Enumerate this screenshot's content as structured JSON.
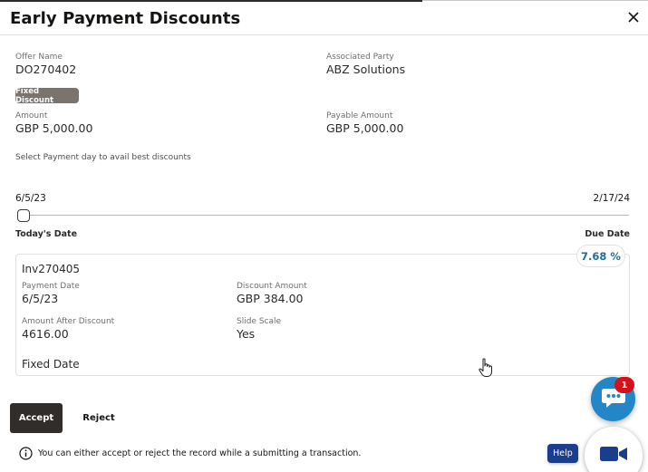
{
  "dialog": {
    "title": "Early Payment Discounts"
  },
  "offer": {
    "offer_name_label": "Offer Name",
    "offer_name": "DO270402",
    "party_label": "Associated Party",
    "party": "ABZ Solutions",
    "badge": "Fixed Discount",
    "amount_label": "Amount",
    "amount": "GBP 5,000.00",
    "payable_label": "Payable Amount",
    "payable": "GBP 5,000.00"
  },
  "slider": {
    "hint": "Select Payment day to avail best discounts",
    "start_date": "6/5/23",
    "end_date": "2/17/24",
    "start_label": "Today's Date",
    "end_label": "Due Date",
    "position": 0
  },
  "card": {
    "discount_percent": "7.68 %",
    "invoice": "Inv270405",
    "payment_date_label": "Payment Date",
    "payment_date": "6/5/23",
    "discount_amount_label": "Discount Amount",
    "discount_amount": "GBP 384.00",
    "after_discount_label": "Amount After Discount",
    "after_discount": "4616.00",
    "slide_scale_label": "Slide Scale",
    "slide_scale": "Yes",
    "footer": "Fixed Date"
  },
  "actions": {
    "accept": "Accept",
    "reject": "Reject",
    "info": "You can either accept or reject the record while a submitting a transaction."
  },
  "widgets": {
    "chat_badge": "1",
    "help": "Help"
  },
  "icons": {
    "close": "close-icon",
    "info": "info-icon",
    "chat": "chat-bubble-icon",
    "video": "video-camera-icon",
    "pointer": "hand-pointer-icon"
  },
  "colors": {
    "accent": "#1f6f95",
    "primary_button": "#312d2a",
    "badge": "#7a736e",
    "chat": "#2386c7",
    "notification": "#d3121b",
    "help": "#1a3e8c",
    "video_icon": "#1a3e8c"
  }
}
